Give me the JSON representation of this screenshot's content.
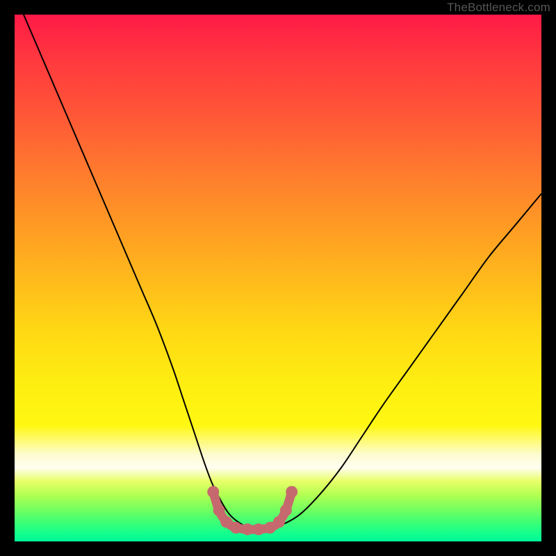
{
  "attribution": "TheBottleneck.com",
  "colors": {
    "frame": "#000000",
    "curve_stroke": "#000000",
    "marker_fill": "#c6696e",
    "marker_stroke": "#c6696e"
  },
  "chart_data": {
    "type": "line",
    "title": "",
    "xlabel": "",
    "ylabel": "",
    "xlim": [
      0,
      100
    ],
    "ylim": [
      0,
      100
    ],
    "grid": false,
    "annotations": [],
    "series": [
      {
        "name": "bottleneck-curve",
        "x": [
          0,
          3,
          6,
          9,
          12,
          15,
          18,
          21,
          24,
          27,
          30,
          32,
          34,
          36,
          37.5,
          39,
          40.5,
          42,
          44,
          46,
          48,
          50,
          54,
          58,
          62,
          66,
          70,
          75,
          80,
          85,
          90,
          95,
          100
        ],
        "y": [
          104,
          97,
          90,
          83,
          76,
          69,
          62,
          55,
          48,
          41,
          33,
          27,
          21,
          15,
          11,
          8,
          5.5,
          4,
          2.8,
          2.3,
          2.3,
          2.8,
          5,
          9,
          14,
          20,
          26,
          33,
          40,
          47,
          54,
          60,
          66
        ]
      }
    ],
    "markers": [
      {
        "x": 37.7,
        "y": 9.4
      },
      {
        "x": 38.8,
        "y": 5.9
      },
      {
        "x": 40.2,
        "y": 3.7
      },
      {
        "x": 42.0,
        "y": 2.6
      },
      {
        "x": 44.2,
        "y": 2.3
      },
      {
        "x": 46.3,
        "y": 2.3
      },
      {
        "x": 48.5,
        "y": 2.6
      },
      {
        "x": 50.2,
        "y": 3.7
      },
      {
        "x": 51.5,
        "y": 5.9
      },
      {
        "x": 52.6,
        "y": 9.4
      }
    ]
  }
}
